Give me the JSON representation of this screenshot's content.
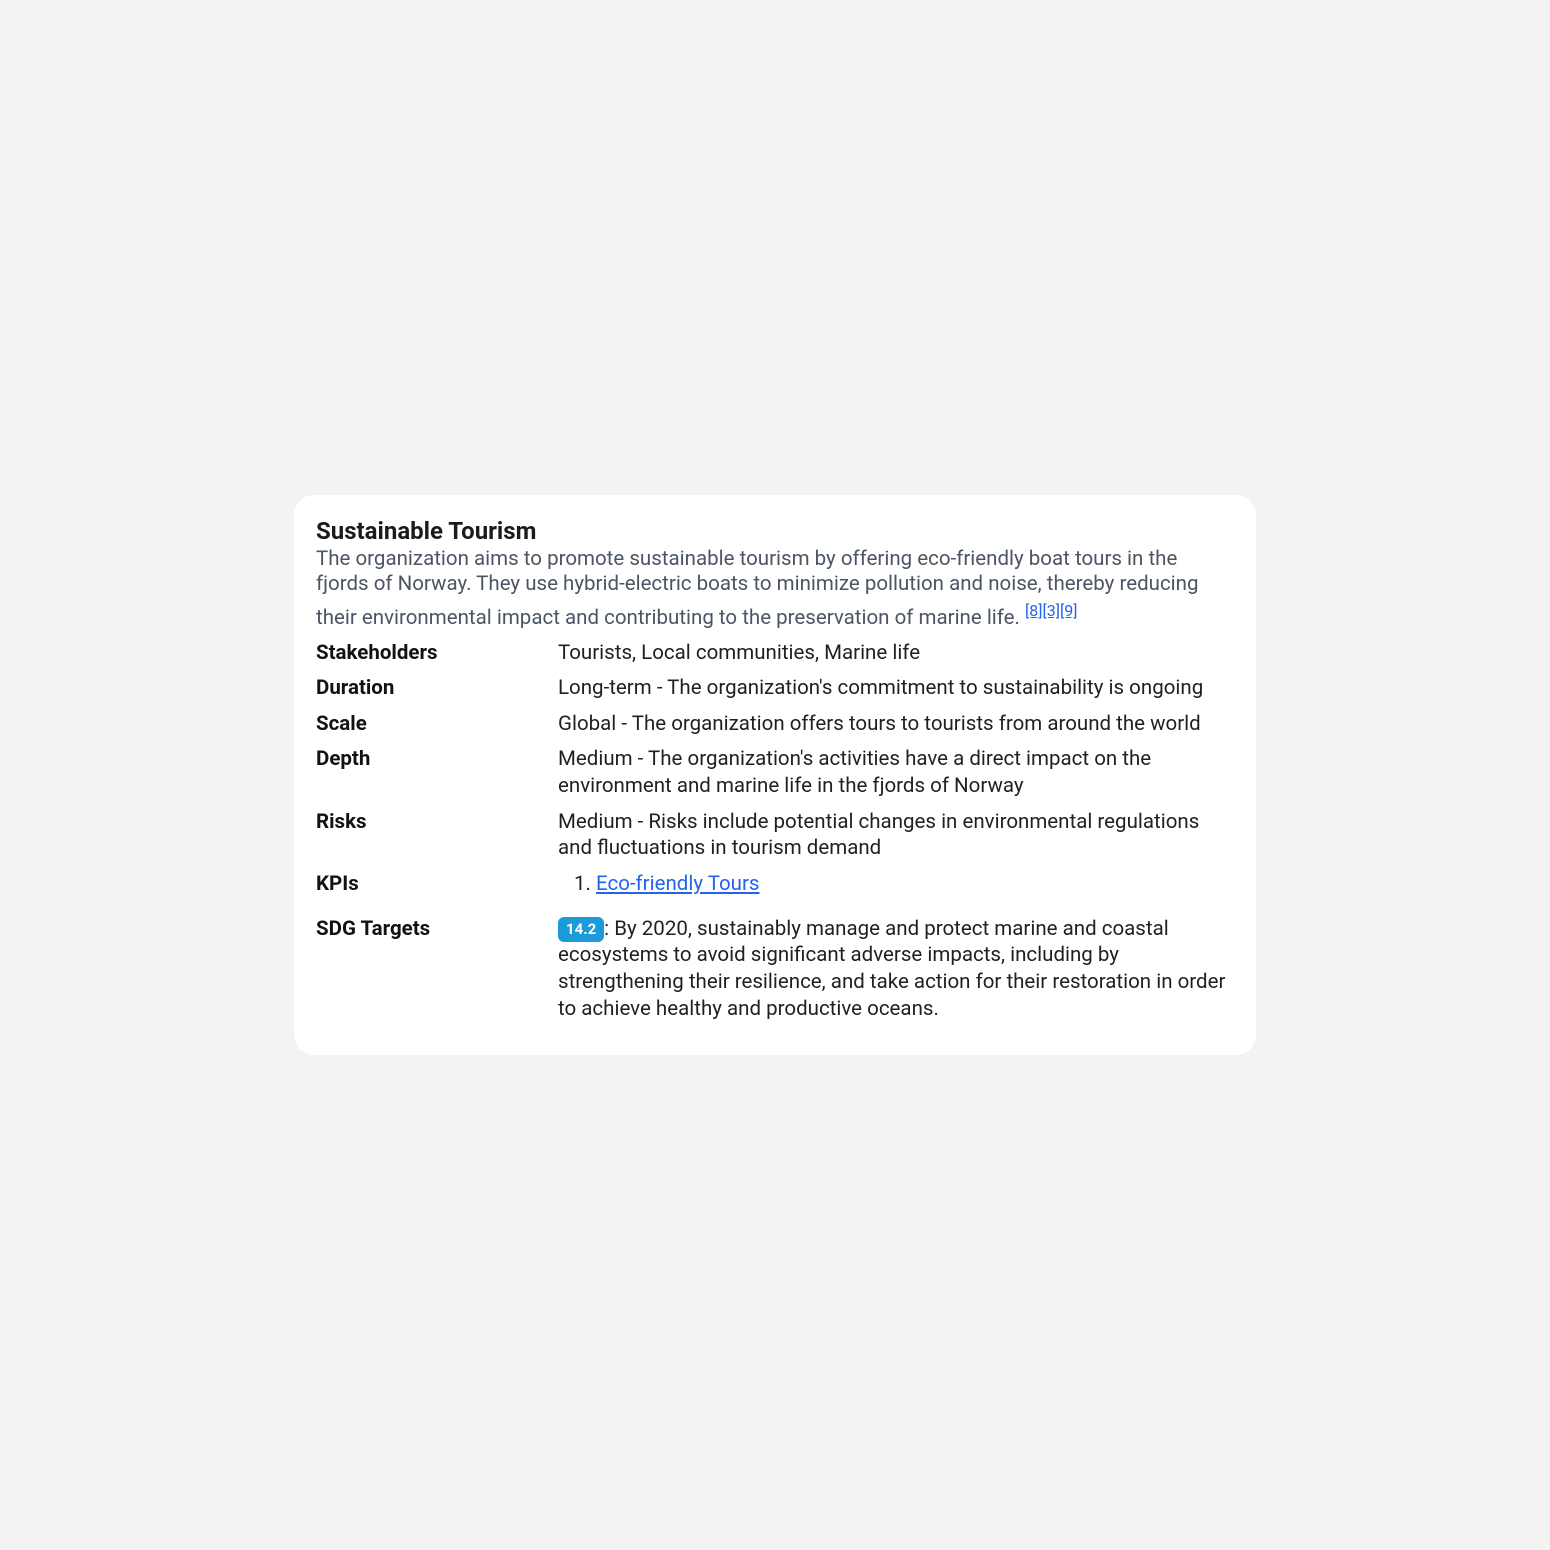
{
  "card": {
    "title": "Sustainable Tourism",
    "description": "The organization aims to promote sustainable tourism by offering eco-friendly boat tours in the fjords of Norway. They use hybrid-electric boats to minimize pollution and noise, thereby reducing their environmental impact and contributing to the preservation of marine life. ",
    "citations": [
      {
        "label": "[8]"
      },
      {
        "label": "[3]"
      },
      {
        "label": "[9]"
      }
    ],
    "attributes": {
      "stakeholders": {
        "label": "Stakeholders",
        "value": "Tourists, Local communities, Marine life"
      },
      "duration": {
        "label": "Duration",
        "value": "Long-term - The organization's commitment to sustainability is ongoing"
      },
      "scale": {
        "label": "Scale",
        "value": "Global - The organization offers tours to tourists from around the world"
      },
      "depth": {
        "label": "Depth",
        "value": "Medium - The organization's activities have a direct impact on the environment and marine life in the fjords of Norway"
      },
      "risks": {
        "label": "Risks",
        "value": "Medium - Risks include potential changes in environmental regulations and fluctuations in tourism demand"
      },
      "kpis": {
        "label": "KPIs",
        "items": [
          "Eco-friendly Tours"
        ]
      },
      "sdg": {
        "label": "SDG Targets",
        "badge": "14.2",
        "text": ": By 2020, sustainably manage and protect marine and coastal ecosystems to avoid significant adverse impacts, including by strengthening their resilience, and take action for their restoration in order to achieve healthy and productive oceans."
      }
    },
    "colors": {
      "link": "#2563eb",
      "badge_bg": "#1d9bd8",
      "badge_fg": "#ffffff",
      "desc_fg": "#4b5563"
    }
  }
}
